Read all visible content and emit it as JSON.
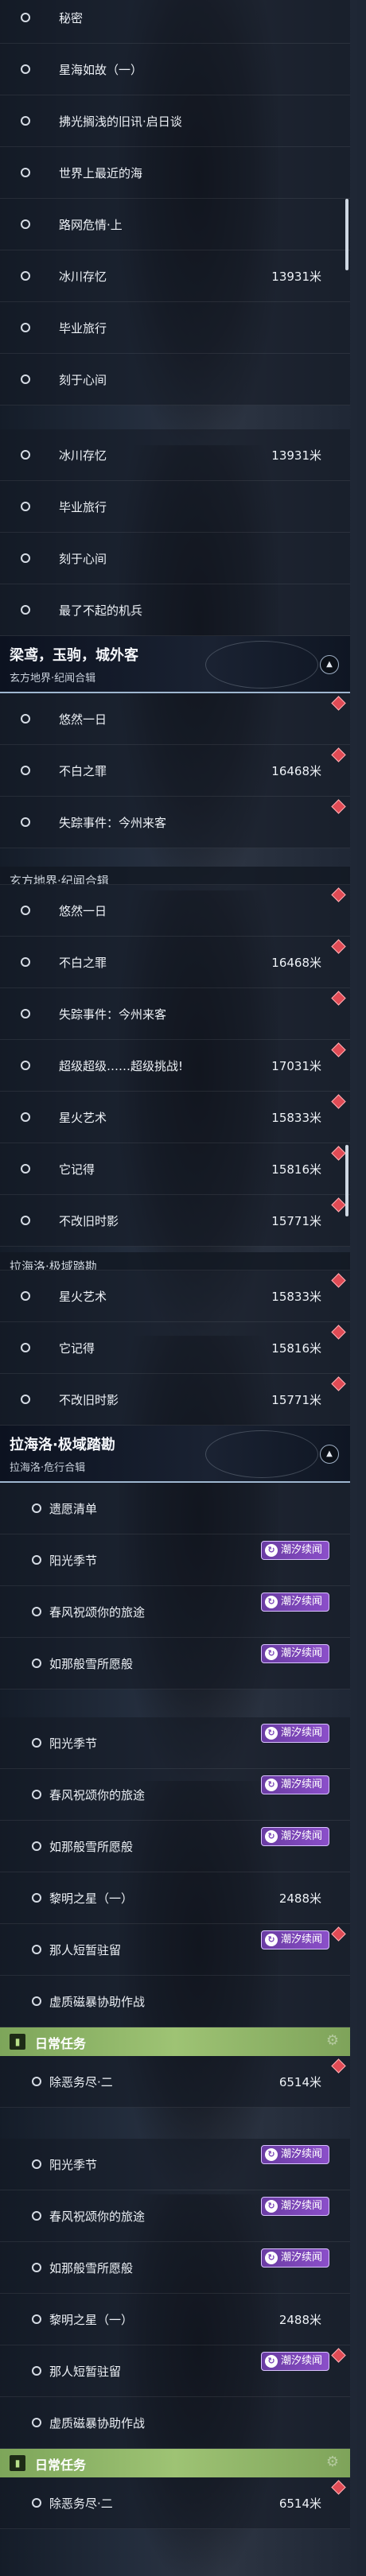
{
  "screen1": [
    {
      "label": "秘密"
    },
    {
      "label": "星海如故（一）"
    },
    {
      "label": "拂光搁浅的旧讯·启日谈"
    },
    {
      "label": "世界上最近的海"
    },
    {
      "label": "路网危情·上"
    },
    {
      "label": "冰川存忆",
      "dist": "13931米"
    },
    {
      "label": "毕业旅行"
    },
    {
      "label": "刻于心间"
    }
  ],
  "screen2_rows": [
    {
      "label": "冰川存忆",
      "dist": "13931米"
    },
    {
      "label": "毕业旅行"
    },
    {
      "label": "刻于心间"
    },
    {
      "label": "最了不起的机兵"
    }
  ],
  "group1": {
    "title": "梁鸢，玉驹，城外客",
    "subtitle": "玄方地界·纪闻合辑",
    "collapse_icon": "▲"
  },
  "group1_rows": [
    {
      "label": "悠然一日"
    },
    {
      "label": "不白之罪",
      "dist": "16468米"
    },
    {
      "label": "失踪事件：今州来客"
    }
  ],
  "screen3_cut": "玄方地界·纪闻合辑",
  "screen3_rows": [
    {
      "label": "悠然一日"
    },
    {
      "label": "不白之罪",
      "dist": "16468米"
    },
    {
      "label": "失踪事件：今州来客"
    },
    {
      "label": "超级超级……超级挑战!",
      "dist": "17031米"
    },
    {
      "label": "星火艺术",
      "dist": "15833米"
    },
    {
      "label": "它记得",
      "dist": "15816米"
    },
    {
      "label": "不改旧时影",
      "dist": "15771米"
    }
  ],
  "screen4_cut": "拉海洛·极域踏勘",
  "screen4_rows": [
    {
      "label": "星火艺术",
      "dist": "15833米"
    },
    {
      "label": "它记得",
      "dist": "15816米"
    },
    {
      "label": "不改旧时影",
      "dist": "15771米"
    }
  ],
  "group2": {
    "title": "拉海洛·极域踏勘",
    "subtitle": "拉海洛·危行合辑",
    "collapse_icon": "▲"
  },
  "group2_rows": [
    {
      "label": "遗愿清单"
    },
    {
      "label": "阳光季节",
      "badge": "潮汐续闻"
    },
    {
      "label": "春风祝颂你的旅途",
      "badge": "潮汐续闻"
    },
    {
      "label": "如那般雪所愿般",
      "badge": "潮汐续闻"
    }
  ],
  "screen5_rows": [
    {
      "label": "阳光季节",
      "badge": "潮汐续闻"
    },
    {
      "label": "春风祝颂你的旅途",
      "badge": "潮汐续闻"
    },
    {
      "label": "如那般雪所愿般",
      "badge": "潮汐续闻"
    },
    {
      "label": "黎明之星（一）",
      "dist": "2488米"
    },
    {
      "label": "那人短暂驻留",
      "badge": "潮汐续闻"
    },
    {
      "label": "虚质磁暴协助作战"
    }
  ],
  "daily": {
    "icon": "▮",
    "title": "日常任务",
    "gear_icon": "⚙"
  },
  "daily_rows": [
    {
      "label": "除恶务尽·二",
      "dist": "6514米"
    }
  ],
  "screen6_rows": [
    {
      "label": "阳光季节",
      "badge": "潮汐续闻"
    },
    {
      "label": "春风祝颂你的旅途",
      "badge": "潮汐续闻"
    },
    {
      "label": "如那般雪所愿般",
      "badge": "潮汐续闻"
    },
    {
      "label": "黎明之星（一）",
      "dist": "2488米"
    },
    {
      "label": "那人短暂驻留",
      "badge": "潮汐续闻"
    },
    {
      "label": "虚质磁暴协助作战"
    }
  ],
  "badge_icon": "↻"
}
